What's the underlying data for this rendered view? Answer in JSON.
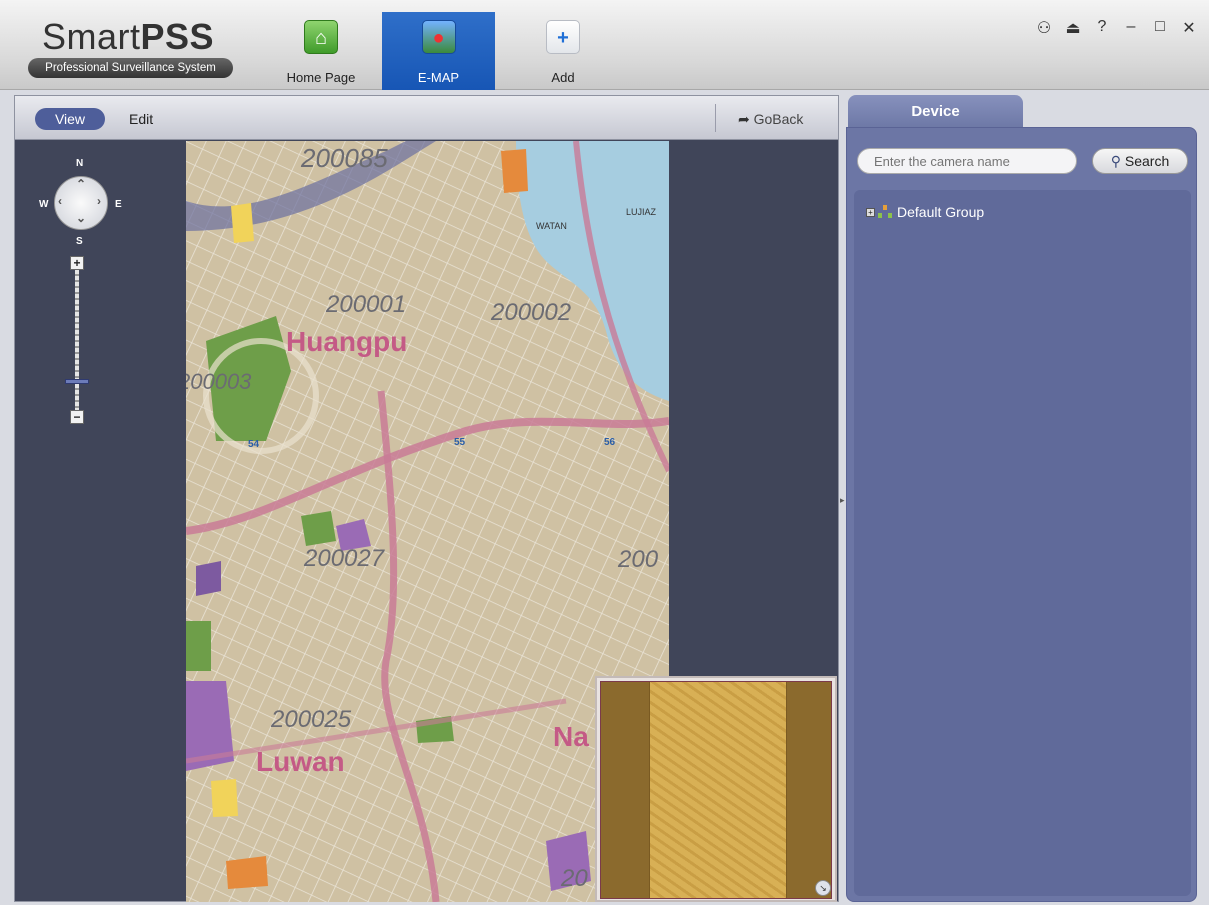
{
  "app": {
    "logo_title_light": "Smart",
    "logo_title_bold": "PSS",
    "logo_subtitle": "Professional Surveillance System"
  },
  "nav": {
    "home_label": "Home Page",
    "emap_label": "E-MAP",
    "add_label": "Add",
    "active": "E-MAP"
  },
  "window_controls": {
    "user": "⚇",
    "lock": "⏏",
    "help": "?",
    "minimize": "–",
    "maximize": "□",
    "close": "✕"
  },
  "toolbar": {
    "view_label": "View",
    "edit_label": "Edit",
    "goback_label": "GoBack"
  },
  "compass": {
    "n": "N",
    "s": "S",
    "e": "E",
    "w": "W",
    "zoom_in": "+",
    "zoom_out": "−",
    "zoom_level": 0.2
  },
  "map": {
    "labels": {
      "z200085": "200085",
      "z200001": "200001",
      "z200002": "200002",
      "z200003": "200003",
      "z200027": "200027",
      "z200025": "200025",
      "z200_right": "200",
      "z20_bottom": "20",
      "huangpu": "Huangpu",
      "luwan": "Luwan",
      "na": "Na",
      "lujiaz": "LUJIAZ",
      "watan": "WATAN",
      "r54": "54",
      "r55": "55",
      "r56": "56"
    },
    "colors": {
      "land": "#cfc1a3",
      "river": "#a6cde0",
      "road": "#c97b97",
      "park": "#6e9e49",
      "district": "#c45a86"
    }
  },
  "device_panel": {
    "tab_label": "Device",
    "search_placeholder": "Enter the camera name",
    "search_button": "Search",
    "tree": [
      {
        "label": "Default Group"
      }
    ]
  }
}
